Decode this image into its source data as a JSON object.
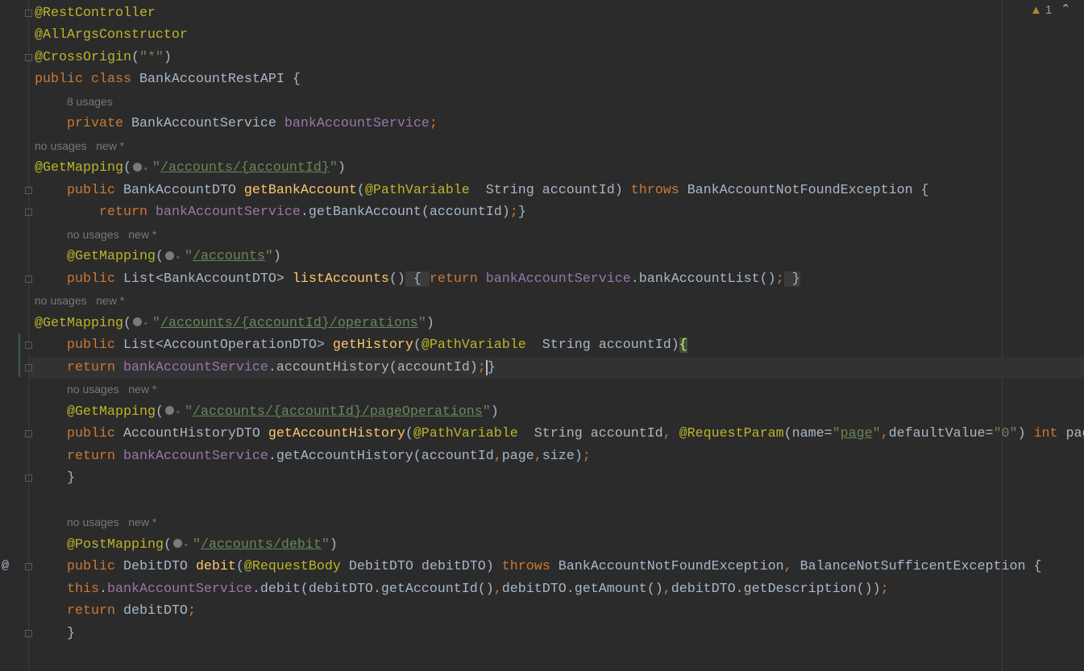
{
  "inspection": {
    "warning_count": "1",
    "warning_icon": "warning-triangle-icon",
    "nav_icon": "chevron-up-icon"
  },
  "gutter_marks": [
    {
      "line": 26,
      "symbol": "@"
    }
  ],
  "colors": {
    "background": "#2b2b2b",
    "keyword": "#cc7832",
    "annotation": "#bbb529",
    "string": "#6a8759",
    "field": "#9876aa",
    "method": "#ffc66d",
    "text": "#a9b7c6"
  },
  "lines": [
    {
      "i": 0,
      "t": [
        [
          "a",
          "@RestController"
        ]
      ],
      "fold": true
    },
    {
      "i": 0,
      "t": [
        [
          "a",
          "@AllArgsConstructor"
        ]
      ]
    },
    {
      "i": 0,
      "t": [
        [
          "a",
          "@CrossOrigin"
        ],
        [
          "p",
          "("
        ],
        [
          "s",
          "\"*\""
        ],
        [
          "p",
          ")"
        ]
      ],
      "fold": true
    },
    {
      "i": 0,
      "t": [
        [
          "k",
          "public class "
        ],
        [
          "p",
          "BankAccountRestAPI {"
        ]
      ]
    },
    {
      "i": 4,
      "hint": "8 usages"
    },
    {
      "i": 4,
      "t": [
        [
          "k",
          "private "
        ],
        [
          "p",
          "BankAccountService "
        ],
        [
          "f",
          "bankAccountService"
        ],
        [
          "k",
          ";"
        ]
      ]
    },
    {
      "i": 0,
      "hint": "no usages   new *"
    },
    {
      "i": 0,
      "t": [
        [
          "a",
          "@GetMapping"
        ],
        [
          "p",
          "("
        ],
        [
          "g",
          ""
        ],
        [
          "s",
          "\""
        ],
        [
          "u",
          "/accounts/{accountId}"
        ],
        [
          "s",
          "\""
        ],
        [
          "p",
          ")"
        ]
      ]
    },
    {
      "i": 4,
      "t": [
        [
          "k",
          "public "
        ],
        [
          "p",
          "BankAccountDTO "
        ],
        [
          "m",
          "getBankAccount"
        ],
        [
          "p",
          "("
        ],
        [
          "a",
          "@PathVariable"
        ],
        [
          "p",
          "  String accountId) "
        ],
        [
          "k",
          "throws "
        ],
        [
          "p",
          "BankAccountNotFoundException {"
        ]
      ],
      "fold": true
    },
    {
      "i": 8,
      "t": [
        [
          "k",
          "return "
        ],
        [
          "f",
          "bankAccountService"
        ],
        [
          "p",
          ".getBankAccount(accountId)"
        ],
        [
          "k",
          ";"
        ],
        [
          "p",
          "}"
        ]
      ],
      "fold": true
    },
    {
      "i": 4,
      "hint": "no usages   new *"
    },
    {
      "i": 4,
      "t": [
        [
          "a",
          "@GetMapping"
        ],
        [
          "p",
          "("
        ],
        [
          "g",
          ""
        ],
        [
          "s",
          "\""
        ],
        [
          "u",
          "/accounts"
        ],
        [
          "s",
          "\""
        ],
        [
          "p",
          ")"
        ]
      ]
    },
    {
      "i": 4,
      "t": [
        [
          "k",
          "public "
        ],
        [
          "p",
          "List<BankAccountDTO> "
        ],
        [
          "m",
          "listAccounts"
        ],
        [
          "p",
          "()"
        ],
        [
          "fold",
          " { "
        ],
        [
          "k",
          "return "
        ],
        [
          "f",
          "bankAccountService"
        ],
        [
          "p",
          ".bankAccountList()"
        ],
        [
          "k",
          ";"
        ],
        [
          "fold",
          " }"
        ]
      ],
      "fold": true
    },
    {
      "i": 0,
      "hint": "no usages   new *"
    },
    {
      "i": 0,
      "t": [
        [
          "a",
          "@GetMapping"
        ],
        [
          "p",
          "("
        ],
        [
          "g",
          ""
        ],
        [
          "s",
          "\""
        ],
        [
          "u",
          "/accounts/{accountId}/operations"
        ],
        [
          "s",
          "\""
        ],
        [
          "p",
          ")"
        ]
      ]
    },
    {
      "i": 4,
      "t": [
        [
          "k",
          "public "
        ],
        [
          "p",
          "List<AccountOperationDTO> "
        ],
        [
          "m",
          "getHistory"
        ],
        [
          "p",
          "("
        ],
        [
          "a",
          "@PathVariable"
        ],
        [
          "p",
          "  String accountId)"
        ],
        [
          "brace",
          "{"
        ]
      ],
      "fold": true
    },
    {
      "i": 4,
      "t": [
        [
          "k",
          "return "
        ],
        [
          "f",
          "bankAccountService"
        ],
        [
          "p",
          ".accountHistory(accountId)"
        ],
        [
          "k",
          ";"
        ],
        [
          "caret",
          "}"
        ]
      ],
      "fold": true,
      "current": true
    },
    {
      "i": 4,
      "hint": "no usages   new *"
    },
    {
      "i": 4,
      "t": [
        [
          "a",
          "@GetMapping"
        ],
        [
          "p",
          "("
        ],
        [
          "g",
          ""
        ],
        [
          "s",
          "\""
        ],
        [
          "u",
          "/accounts/{accountId}/pageOperations"
        ],
        [
          "s",
          "\""
        ],
        [
          "p",
          ")"
        ]
      ]
    },
    {
      "i": 4,
      "t": [
        [
          "k",
          "public "
        ],
        [
          "p",
          "AccountHistoryDTO "
        ],
        [
          "m",
          "getAccountHistory"
        ],
        [
          "p",
          "("
        ],
        [
          "a",
          "@PathVariable"
        ],
        [
          "p",
          "  String accountId"
        ],
        [
          "k",
          ", "
        ],
        [
          "a",
          "@RequestParam"
        ],
        [
          "p",
          "(name="
        ],
        [
          "s",
          "\""
        ],
        [
          "u",
          "page"
        ],
        [
          "s",
          "\""
        ],
        [
          "k",
          ","
        ],
        [
          "p",
          "defaultValue="
        ],
        [
          "s",
          "\"0\""
        ],
        [
          "p",
          ") "
        ],
        [
          "k",
          "int "
        ],
        [
          "p",
          "pag"
        ]
      ],
      "fold": true
    },
    {
      "i": 4,
      "t": [
        [
          "k",
          "return "
        ],
        [
          "f",
          "bankAccountService"
        ],
        [
          "p",
          ".getAccountHistory(accountId"
        ],
        [
          "k",
          ","
        ],
        [
          "p",
          "page"
        ],
        [
          "k",
          ","
        ],
        [
          "p",
          "size)"
        ],
        [
          "k",
          ";"
        ]
      ]
    },
    {
      "i": 4,
      "t": [
        [
          "p",
          "}"
        ]
      ],
      "fold": true
    },
    {
      "i": 0,
      "t": []
    },
    {
      "i": 4,
      "hint": "no usages   new *"
    },
    {
      "i": 4,
      "t": [
        [
          "a",
          "@PostMapping"
        ],
        [
          "p",
          "("
        ],
        [
          "g",
          ""
        ],
        [
          "s",
          "\""
        ],
        [
          "u",
          "/accounts/debit"
        ],
        [
          "s",
          "\""
        ],
        [
          "p",
          ")"
        ]
      ]
    },
    {
      "i": 4,
      "t": [
        [
          "k",
          "public "
        ],
        [
          "p",
          "DebitDTO "
        ],
        [
          "m",
          "debit"
        ],
        [
          "p",
          "("
        ],
        [
          "a",
          "@RequestBody "
        ],
        [
          "p",
          "DebitDTO debitDTO) "
        ],
        [
          "k",
          "throws "
        ],
        [
          "p",
          "BankAccountNotFoundException"
        ],
        [
          "k",
          ", "
        ],
        [
          "p",
          "BalanceNotSufficentException {"
        ]
      ],
      "fold": true
    },
    {
      "i": 4,
      "t": [
        [
          "k",
          "this"
        ],
        [
          "p",
          "."
        ],
        [
          "f",
          "bankAccountService"
        ],
        [
          "p",
          ".debit(debitDTO.getAccountId()"
        ],
        [
          "k",
          ","
        ],
        [
          "p",
          "debitDTO.getAmount()"
        ],
        [
          "k",
          ","
        ],
        [
          "p",
          "debitDTO.getDescription())"
        ],
        [
          "k",
          ";"
        ]
      ]
    },
    {
      "i": 4,
      "t": [
        [
          "k",
          "return "
        ],
        [
          "p",
          "debitDTO"
        ],
        [
          "k",
          ";"
        ]
      ]
    },
    {
      "i": 4,
      "t": [
        [
          "p",
          "}"
        ]
      ],
      "fold": true
    }
  ]
}
